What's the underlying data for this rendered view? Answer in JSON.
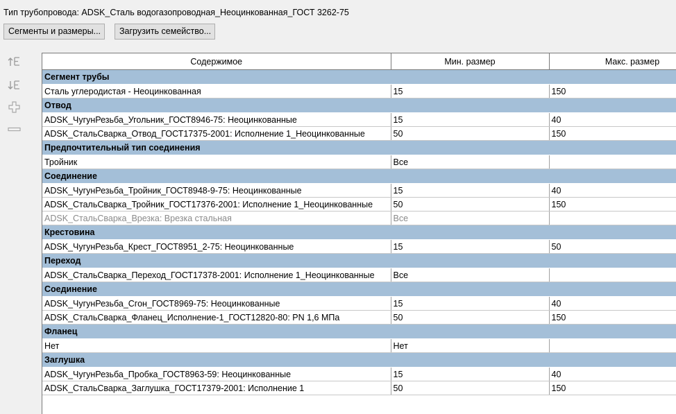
{
  "header": {
    "title": "Тип трубопровода: ADSK_Сталь водогазопроводная_Неоцинкованная_ГОСТ 3262-75",
    "segments_button": "Сегменты и размеры...",
    "load_family_button": "Загрузить семейство..."
  },
  "toolbar": [
    "move-up-icon",
    "move-down-icon",
    "add-row-icon",
    "remove-row-icon"
  ],
  "columns": [
    "Содержимое",
    "Мин. размер",
    "Макс. размер"
  ],
  "rows": [
    {
      "type": "group",
      "name": "Сегмент трубы"
    },
    {
      "type": "data",
      "name": "Сталь углеродистая - Неоцинкованная",
      "min": "15",
      "max": "150"
    },
    {
      "type": "group",
      "name": "Отвод"
    },
    {
      "type": "data",
      "name": "ADSK_ЧугунРезьба_Угольник_ГОСТ8946-75: Неоцинкованные",
      "min": "15",
      "max": "40"
    },
    {
      "type": "data",
      "name": "ADSK_СтальСварка_Отвод_ГОСТ17375-2001: Исполнение 1_Неоцинкованные",
      "min": "50",
      "max": "150"
    },
    {
      "type": "group",
      "name": "Предпочтительный тип соединения"
    },
    {
      "type": "data",
      "name": "Тройник",
      "min": "Все",
      "max": ""
    },
    {
      "type": "group",
      "name": "Соединение"
    },
    {
      "type": "data",
      "name": "ADSK_ЧугунРезьба_Тройник_ГОСТ8948-9-75: Неоцинкованные",
      "min": "15",
      "max": "40"
    },
    {
      "type": "data",
      "name": "ADSK_СтальСварка_Тройник_ГОСТ17376-2001: Исполнение 1_Неоцинкованные",
      "min": "50",
      "max": "150"
    },
    {
      "type": "data",
      "name": "ADSK_СтальСварка_Врезка: Врезка стальная",
      "min": "Все",
      "max": "",
      "disabled": true
    },
    {
      "type": "group",
      "name": "Крестовина"
    },
    {
      "type": "data",
      "name": "ADSK_ЧугунРезьба_Крест_ГОСТ8951_2-75: Неоцинкованные",
      "min": "15",
      "max": "50"
    },
    {
      "type": "group",
      "name": "Переход"
    },
    {
      "type": "data",
      "name": "ADSK_СтальСварка_Переход_ГОСТ17378-2001: Исполнение 1_Неоцинкованные",
      "min": "Все",
      "max": ""
    },
    {
      "type": "group",
      "name": "Соединение"
    },
    {
      "type": "data",
      "name": "ADSK_ЧугунРезьба_Сгон_ГОСТ8969-75: Неоцинкованные",
      "min": "15",
      "max": "40"
    },
    {
      "type": "data",
      "name": "ADSK_СтальСварка_Фланец_Исполнение-1_ГОСТ12820-80: PN 1,6 МПа",
      "min": "50",
      "max": "150"
    },
    {
      "type": "group",
      "name": "Фланец"
    },
    {
      "type": "data",
      "name": "Нет",
      "min": "Нет",
      "max": ""
    },
    {
      "type": "group",
      "name": "Заглушка"
    },
    {
      "type": "data",
      "name": "ADSK_ЧугунРезьба_Пробка_ГОСТ8963-59: Неоцинкованные",
      "min": "15",
      "max": "40"
    },
    {
      "type": "data",
      "name": "ADSK_СтальСварка_Заглушка_ГОСТ17379-2001: Исполнение 1",
      "min": "50",
      "max": "150"
    }
  ]
}
